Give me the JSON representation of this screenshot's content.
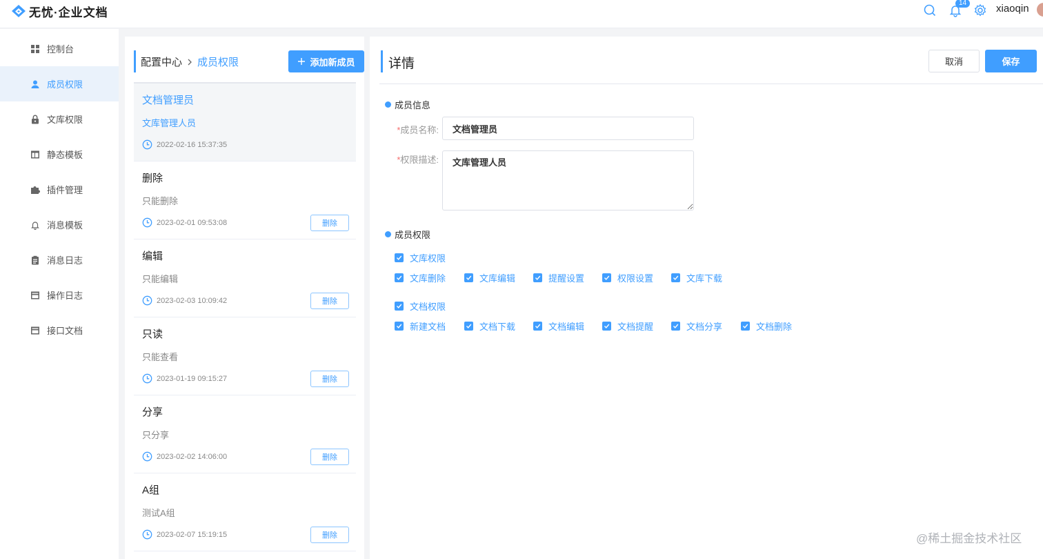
{
  "app": {
    "title": "无忧·企业文档",
    "notification_count": "14",
    "username": "xiaoqin"
  },
  "colors": {
    "accent": "#409eff",
    "required": "#f56c6c"
  },
  "sidebar": {
    "items": [
      {
        "label": "控制台",
        "icon": "dashboard-icon"
      },
      {
        "label": "成员权限",
        "icon": "user-icon",
        "active": true
      },
      {
        "label": "文库权限",
        "icon": "lock-icon"
      },
      {
        "label": "静态模板",
        "icon": "template-icon"
      },
      {
        "label": "插件管理",
        "icon": "puzzle-icon"
      },
      {
        "label": "消息模板",
        "icon": "bell-icon"
      },
      {
        "label": "消息日志",
        "icon": "clipboard-icon"
      },
      {
        "label": "操作日志",
        "icon": "list-icon"
      },
      {
        "label": "接口文档",
        "icon": "doc-icon"
      }
    ]
  },
  "members": {
    "breadcrumb": {
      "root": "配置中心",
      "current": "成员权限"
    },
    "add_label": "添加新成员",
    "delete_label": "删除",
    "cards": [
      {
        "title": "文档管理员",
        "desc": "文库管理人员",
        "time": "2022-02-16 15:37:35",
        "selected": true
      },
      {
        "title": "删除",
        "desc": "只能删除",
        "time": "2023-02-01 09:53:08"
      },
      {
        "title": "编辑",
        "desc": "只能编辑",
        "time": "2023-02-03 10:09:42"
      },
      {
        "title": "只读",
        "desc": "只能查看",
        "time": "2023-01-19 09:15:27"
      },
      {
        "title": "分享",
        "desc": "只分享",
        "time": "2023-02-02 14:06:00"
      },
      {
        "title": "A组",
        "desc": "测试A组",
        "time": "2023-02-07 15:19:15"
      }
    ]
  },
  "detail": {
    "title": "详情",
    "cancel_label": "取消",
    "save_label": "保存",
    "info_section": "成员信息",
    "name_label": "成员名称:",
    "name_value": "文档管理员",
    "desc_label": "权限描述:",
    "desc_value": "文库管理人员",
    "perm_section": "成员权限",
    "library_group": "文库权限",
    "library_perms": [
      "文库删除",
      "文库编辑",
      "提醒设置",
      "权限设置",
      "文库下载"
    ],
    "doc_group": "文档权限",
    "doc_perms": [
      "新建文档",
      "文档下载",
      "文档编辑",
      "文档提醒",
      "文档分享",
      "文档删除"
    ]
  },
  "watermark": "@稀土掘金技术社区"
}
